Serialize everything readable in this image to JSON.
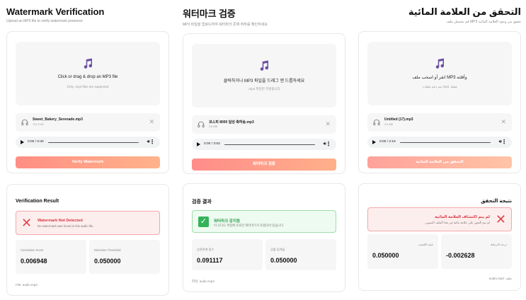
{
  "panels": [
    {
      "lang": "en",
      "header": {
        "title": "Watermark Verification",
        "subtitle": "Upload an MP3 file to verify watermark presence"
      },
      "upload": {
        "drop_text": "Click or drag & drop an MP3 file",
        "drop_sub": "Only .mp3 files are supported"
      },
      "file": {
        "name": "Sweet_Bakery_Serenade.mp3",
        "size": "721.3 KB"
      },
      "player": {
        "time": "0:00 / 0:30"
      },
      "verify_button": "Verify Watermark",
      "result": {
        "title": "Verification Result",
        "status": "error",
        "alert_title": "Watermark Not Detected",
        "alert_sub": "No watermark was found in this audio file.",
        "correlation_label": "Correlation Score",
        "correlation_value": "0.006948",
        "threshold_label": "Detection Threshold",
        "threshold_value": "0.050000",
        "file_line": "File: audio.mp3"
      }
    },
    {
      "lang": "ko",
      "header": {
        "title": "워터마크 검증",
        "subtitle": "MP3 파일을 업로드하여 워터마크 존재 여부를 확인하세요"
      },
      "upload": {
        "drop_text": "클릭하거나 MP3 파일을 드래그 앤 드롭하세요",
        "drop_sub": ".mp3 파일만 지원됩니다"
      },
      "file": {
        "name": "코스피 8000 달성 축하송.mp3",
        "size": "3.6 MB"
      },
      "player": {
        "time": "0:00 / 3:53"
      },
      "verify_button": "워터마크 검증",
      "result": {
        "title": "검증 결과",
        "status": "success",
        "alert_title": "워터마크 감지됨",
        "alert_sub": "이 오디오 파일에 유효한 워터마크가 포함되어 있습니다.",
        "correlation_label": "상관관계 점수",
        "correlation_value": "0.091117",
        "threshold_label": "검출 임계값",
        "threshold_value": "0.050000",
        "file_line": "파일: audio.mp3"
      }
    },
    {
      "lang": "ar",
      "header": {
        "title": "التحقق من العلامة المائية",
        "subtitle": "تحقق من وجود العلامة المائية MP3 قم بتحميل ملف"
      },
      "upload": {
        "drop_text": "وأفلته MP3 انقر أو اسحب ملف",
        "drop_sub": "فقط .mp3 يتم دعم ملفات"
      },
      "file": {
        "name": "Untitled (17).mp3",
        "size": "3.0 MB"
      },
      "player": {
        "time": "0:00 / 2:19"
      },
      "verify_button": "التحقق من العلامة المائية",
      "result": {
        "title": "نتيجة التحقق",
        "status": "error",
        "alert_title": "لم يتم اكتشاف العلامة المائية",
        "alert_sub": "لم يتم العثور على علامة مائية في هذا الملف الصوتي",
        "correlation_label": "درجة الارتباط",
        "correlation_value": "-0.002628",
        "threshold_label": "عتبة الكشف",
        "threshold_value": "0.050000",
        "file_line": "ملف: audio.mp3"
      }
    }
  ],
  "colors": {
    "accent": "#6b4fa0",
    "button_start": "#ff8e84",
    "button_end": "#ffb38a",
    "error": "#e0454d",
    "success": "#34b35a"
  }
}
